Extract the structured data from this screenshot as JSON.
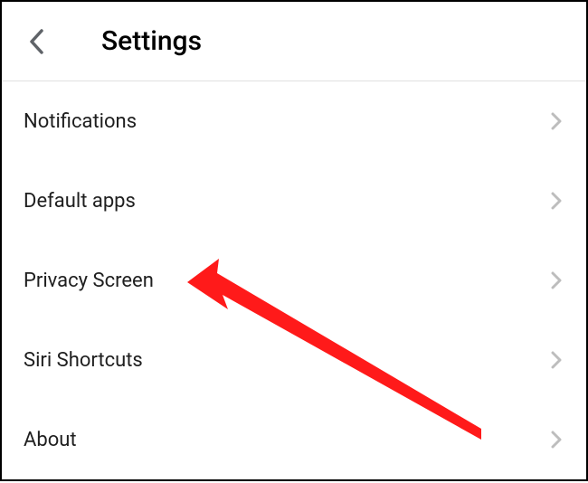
{
  "header": {
    "title": "Settings"
  },
  "list": {
    "items": [
      {
        "label": "Notifications"
      },
      {
        "label": "Default apps"
      },
      {
        "label": "Privacy Screen"
      },
      {
        "label": "Siri Shortcuts"
      },
      {
        "label": "About"
      }
    ]
  }
}
